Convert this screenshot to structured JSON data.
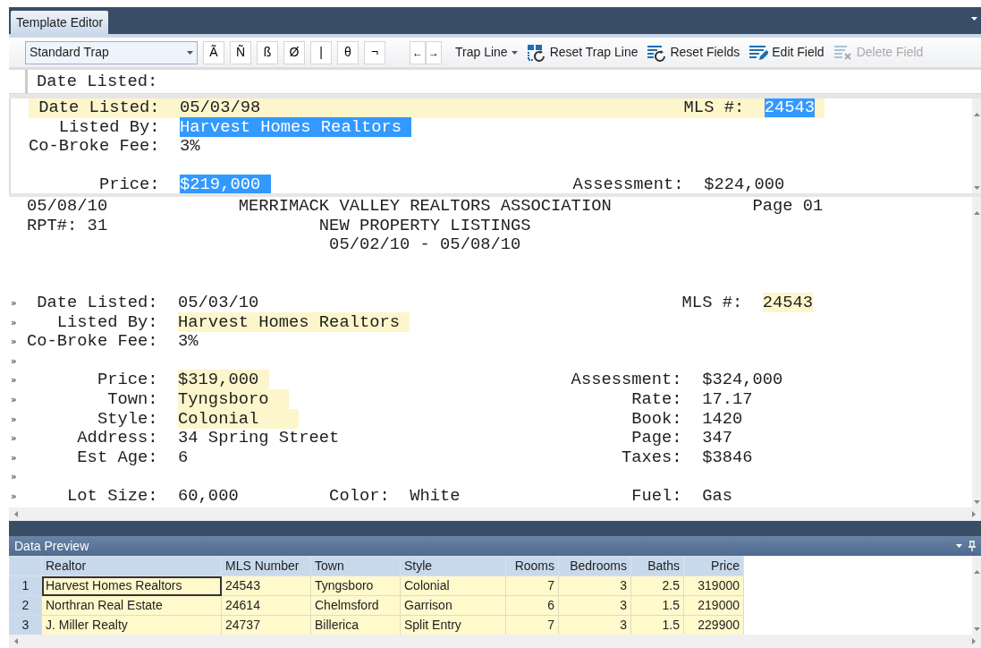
{
  "tabs": [
    {
      "label": "Template Editor",
      "selected": true
    }
  ],
  "toolbar": {
    "trap_select": {
      "value": "Standard Trap"
    },
    "char_buttons": [
      "Ã",
      "Ñ",
      "ß",
      "Ø",
      "|",
      "θ",
      "¬"
    ],
    "nav_buttons": [
      "←",
      "→"
    ],
    "trap_line_menu": {
      "label": "Trap Line"
    },
    "actions": [
      {
        "label": "Reset Trap Line",
        "kind": "reset-trap-line",
        "disabled": false
      },
      {
        "label": "Reset Fields",
        "kind": "reset-fields",
        "disabled": false
      },
      {
        "label": "Edit Field",
        "kind": "edit-field",
        "disabled": false
      },
      {
        "label": "Delete Field",
        "kind": "delete-field",
        "disabled": true
      }
    ]
  },
  "trap_line_field": {
    "value": "Date Listed:"
  },
  "template_preview": {
    "lines": [
      {
        "current": true,
        "segments": [
          {
            "kind": "plain",
            "text": " Date Listed:  05/03/98                                          MLS #:  "
          },
          {
            "kind": "selected",
            "text": "24543"
          }
        ]
      },
      {
        "segments": [
          {
            "kind": "plain",
            "text": "   Listed By:  "
          },
          {
            "kind": "selected",
            "text": "Harvest Homes Realtors "
          }
        ]
      },
      {
        "segments": [
          {
            "kind": "plain",
            "text": "Co-Broke Fee:  3%"
          }
        ]
      },
      {
        "blank": true
      },
      {
        "segments": [
          {
            "kind": "plain",
            "text": "       Price:  "
          },
          {
            "kind": "selected",
            "text": "$219,000 "
          },
          {
            "kind": "plain",
            "text": "                              Assessment:  $224,000"
          }
        ]
      }
    ]
  },
  "report": {
    "lines": [
      {
        "segments": [
          {
            "kind": "plain",
            "text": "05/08/10             MERRIMACK VALLEY REALTORS ASSOCIATION              Page 01"
          }
        ]
      },
      {
        "segments": [
          {
            "kind": "plain",
            "text": "RPT#: 31                     NEW PROPERTY LISTINGS"
          }
        ]
      },
      {
        "segments": [
          {
            "kind": "plain",
            "text": "                              05/02/10 - 05/08/10"
          }
        ]
      },
      {
        "blank": true
      },
      {
        "blank": true
      },
      {
        "marker": "»",
        "segments": [
          {
            "kind": "plain",
            "text": " Date Listed:  05/03/10                                          MLS #:  "
          },
          {
            "kind": "field",
            "text": "24543"
          }
        ]
      },
      {
        "marker": "»",
        "segments": [
          {
            "kind": "plain",
            "text": "   Listed By:  "
          },
          {
            "kind": "field",
            "text": "Harvest Homes Realtors "
          }
        ]
      },
      {
        "marker": "»",
        "segments": [
          {
            "kind": "plain",
            "text": "Co-Broke Fee:  3%"
          }
        ]
      },
      {
        "marker": "»"
      },
      {
        "marker": "»",
        "segments": [
          {
            "kind": "plain",
            "text": "       Price:  "
          },
          {
            "kind": "field",
            "text": "$319,000 "
          },
          {
            "kind": "plain",
            "text": "                              Assessment:  $324,000"
          }
        ]
      },
      {
        "marker": "»",
        "segments": [
          {
            "kind": "plain",
            "text": "        Town:  "
          },
          {
            "kind": "field",
            "text": "Tyngsboro  "
          },
          {
            "kind": "plain",
            "text": "                                  Rate:  17.17"
          }
        ]
      },
      {
        "marker": "»",
        "segments": [
          {
            "kind": "plain",
            "text": "       Style:  "
          },
          {
            "kind": "field",
            "text": "Colonial    "
          },
          {
            "kind": "plain",
            "text": "                                 Book:  1420"
          }
        ]
      },
      {
        "marker": "»",
        "segments": [
          {
            "kind": "plain",
            "text": "     Address:  34 Spring Street                             Page:  347"
          }
        ]
      },
      {
        "marker": "»",
        "segments": [
          {
            "kind": "plain",
            "text": "     Est Age:  6                                           Taxes:  $3846"
          }
        ]
      },
      {
        "marker": "»"
      },
      {
        "marker": "»",
        "segments": [
          {
            "kind": "plain",
            "text": "    Lot Size:  60,000         Color:  White                 Fuel:  Gas"
          }
        ]
      }
    ]
  },
  "data_preview": {
    "title": "Data Preview",
    "columns": [
      {
        "label": "Realtor",
        "kind": "text"
      },
      {
        "label": "MLS Number",
        "kind": "text"
      },
      {
        "label": "Town",
        "kind": "text"
      },
      {
        "label": "Style",
        "kind": "text"
      },
      {
        "label": "Rooms",
        "kind": "number"
      },
      {
        "label": "Bedrooms",
        "kind": "number"
      },
      {
        "label": "Baths",
        "kind": "number"
      },
      {
        "label": "Price",
        "kind": "number"
      }
    ],
    "rows": [
      {
        "number": "1",
        "selected": true,
        "cells": [
          "Harvest Homes Realtors",
          "24543",
          "Tyngsboro",
          "Colonial",
          "7",
          "3",
          "2.5",
          "319000"
        ]
      },
      {
        "number": "2",
        "selected": false,
        "cells": [
          "Northran Real Estate",
          "24614",
          "Chelmsford",
          "Garrison",
          "6",
          "3",
          "1.5",
          "219000"
        ]
      },
      {
        "number": "3",
        "selected": false,
        "cells": [
          "J. Miller Realty",
          "24737",
          "Billerica",
          "Split Entry",
          "7",
          "3",
          "1.5",
          "229900"
        ]
      }
    ]
  }
}
